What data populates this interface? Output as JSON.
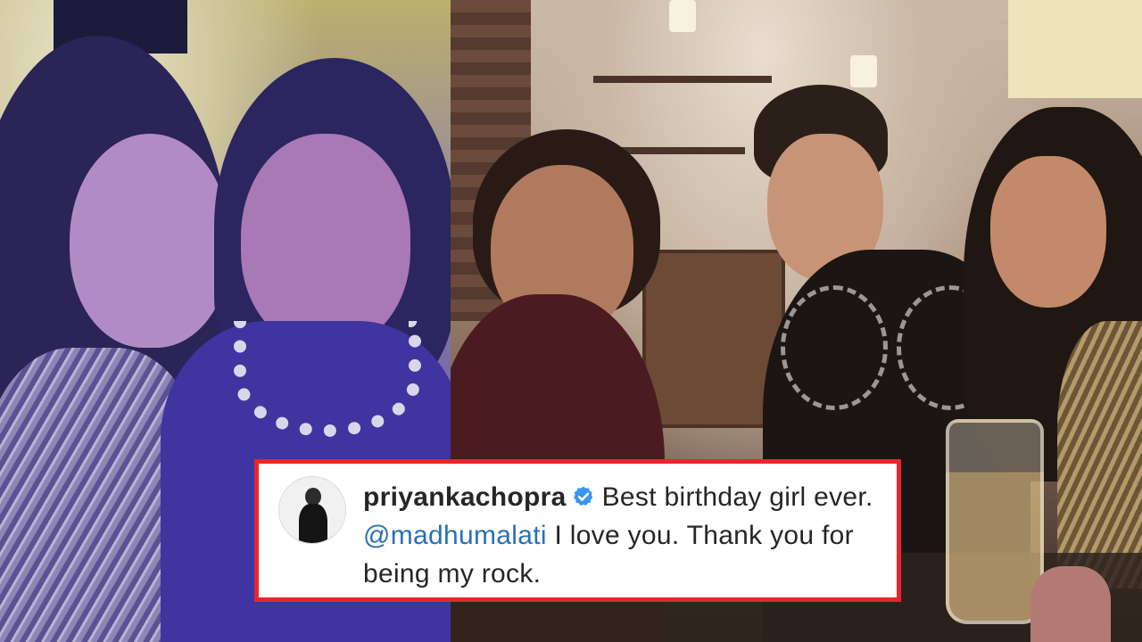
{
  "caption": {
    "username": "priyankachopra",
    "verified_icon": "verified-badge-icon",
    "text_before_mention": "Best birthday girl ever.",
    "mention": "@madhumalati",
    "text_after_mention": "I love you. Thank you for being my rock."
  },
  "colors": {
    "card_border": "#e5272d",
    "verified_badge": "#3897f0",
    "mention": "#2a6fb8",
    "text": "#262626"
  }
}
